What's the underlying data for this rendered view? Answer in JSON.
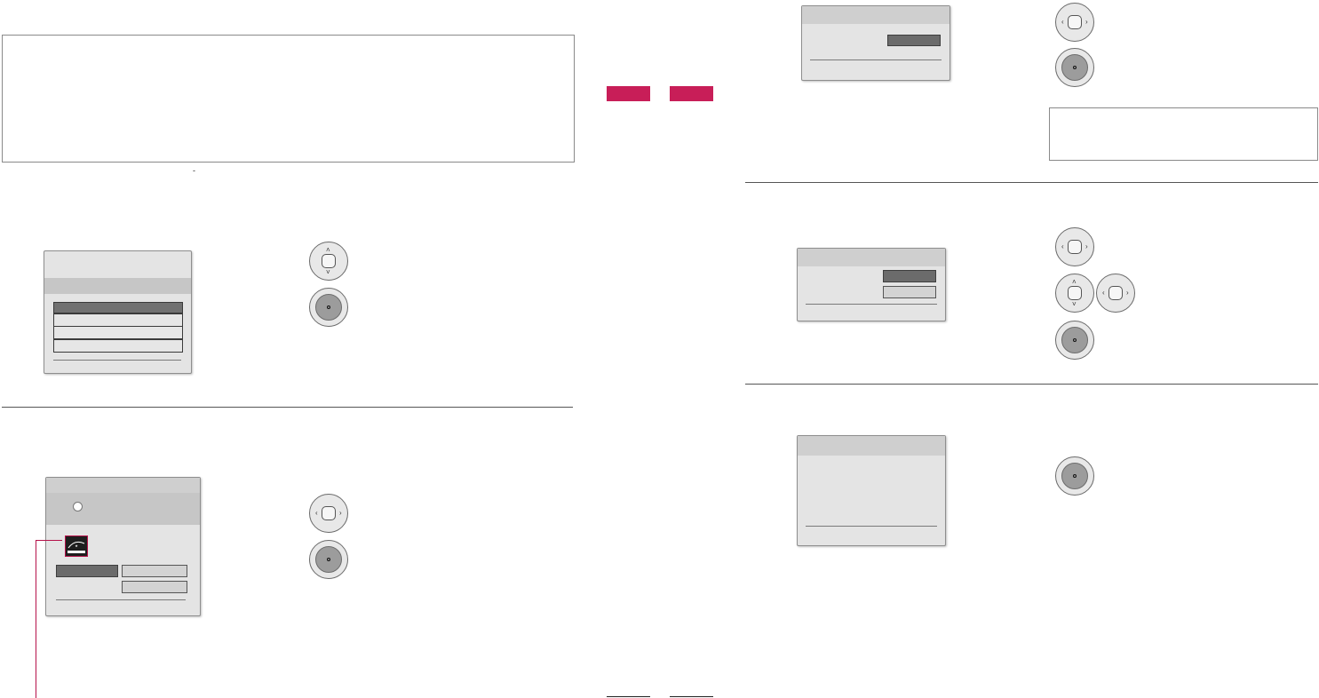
{
  "page": {
    "accent_color": "#c81e58",
    "panel_color": "#e4e4e4",
    "highlight_color": "#6b6b6b"
  },
  "note": {
    "text": "-"
  },
  "tabs": [
    {
      "label": ""
    },
    {
      "label": ""
    }
  ],
  "steps": [
    {
      "id": "step-1",
      "buttons": [
        "nav-up-down-icon",
        "ok-icon"
      ]
    },
    {
      "id": "step-2",
      "buttons": [
        "nav-left-right-icon",
        "ok-icon"
      ],
      "logo": "energy-star-logo"
    },
    {
      "id": "step-3",
      "buttons": [
        "nav-left-right-icon",
        "ok-icon"
      ]
    },
    {
      "id": "step-4",
      "buttons": [
        "nav-left-right-icon",
        "nav-up-down-icon",
        "nav-left-right-icon",
        "ok-icon"
      ]
    },
    {
      "id": "step-5",
      "buttons": [
        "ok-icon"
      ]
    }
  ]
}
